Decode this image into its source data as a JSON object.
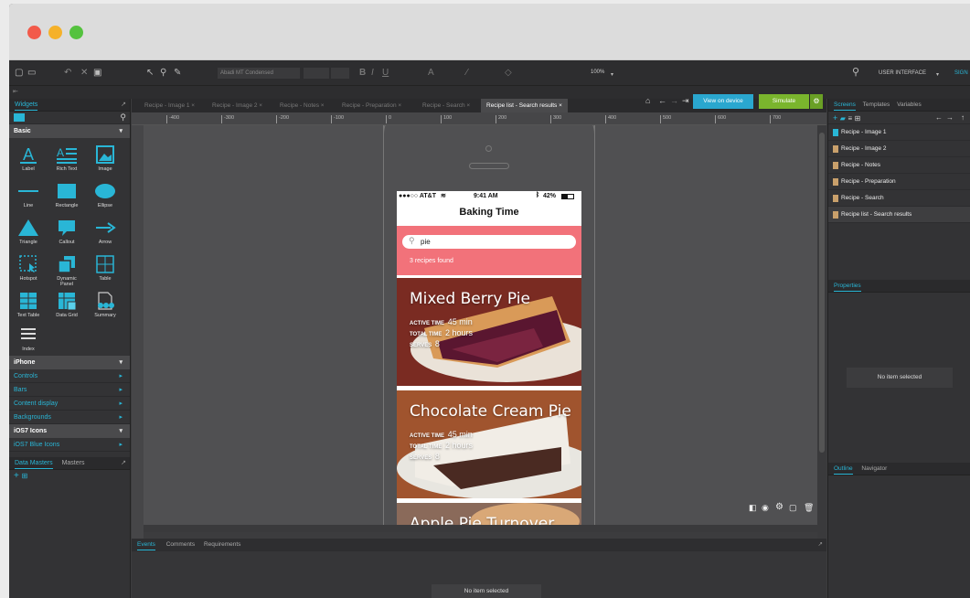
{
  "toolbar": {
    "font_family": "Abadi MT Condensed",
    "zoom": "100%",
    "mode_label": "USER INTERFACE",
    "sign_label": "SIGN"
  },
  "left_panel": {
    "tab_widgets": "Widgets",
    "section_basic": "Basic",
    "widgets": [
      "Label",
      "Rich Text",
      "Image",
      "Line",
      "Rectangle",
      "Ellipse",
      "Triangle",
      "Callout",
      "Arrow",
      "Hotspot",
      "Dynamic Panel",
      "Table",
      "Text Table",
      "Data Grid",
      "Summary",
      "Index"
    ],
    "section_iphone": "iPhone",
    "iphone_cats": [
      "Controls",
      "Bars",
      "Content display",
      "Backgrounds"
    ],
    "section_ios7": "iOS7 Icons",
    "ios7_cats": [
      "iOS7 Blue Icons"
    ],
    "tab_data_masters": "Data Masters",
    "tab_masters": "Masters"
  },
  "tabs": [
    "Recipe - Image 1",
    "Recipe - Image 2",
    "Recipe - Notes",
    "Recipe - Preparation",
    "Recipe - Search",
    "Recipe list - Search results"
  ],
  "buttons": {
    "view_on_device": "View on device",
    "simulate": "Simulate"
  },
  "ruler": [
    "-400",
    "-300",
    "-200",
    "-100",
    "0",
    "100",
    "200",
    "300",
    "400",
    "500",
    "600",
    "700"
  ],
  "phone": {
    "carrier": "●●●○○ AT&T",
    "time": "9:41 AM",
    "battery": "42%",
    "title": "Baking Time",
    "search_value": "pie",
    "found": "3 recipes found",
    "label_active": "ACTIVE TIME",
    "label_total": "TOTAL TIME",
    "label_serves": "SERVES",
    "recipes": [
      {
        "name": "Mixed Berry Pie",
        "active": "45 min",
        "total": "2 hours",
        "serves": "8"
      },
      {
        "name": "Chocolate Cream Pie",
        "active": "45 min",
        "total": "2 hours",
        "serves": "8"
      },
      {
        "name": "Apple Pie Turnover",
        "active": "",
        "total": "",
        "serves": ""
      }
    ]
  },
  "bottom": {
    "tab_events": "Events",
    "tab_comments": "Comments",
    "tab_requirements": "Requirements",
    "no_item": "No item selected"
  },
  "right_panel": {
    "tab_screens": "Screens",
    "tab_templates": "Templates",
    "tab_variables": "Variables",
    "screens": [
      "Recipe - Image 1",
      "Recipe - Image 2",
      "Recipe - Notes",
      "Recipe - Preparation",
      "Recipe - Search",
      "Recipe list - Search results"
    ],
    "tab_properties": "Properties",
    "no_item": "No item selected",
    "tab_outline": "Outline",
    "tab_navigator": "Navigator"
  },
  "colors": {
    "accent": "#29b6d6",
    "view_on_device": "#2aa7cf",
    "simulate": "#7ab52d",
    "search_band": "#f2727a"
  }
}
